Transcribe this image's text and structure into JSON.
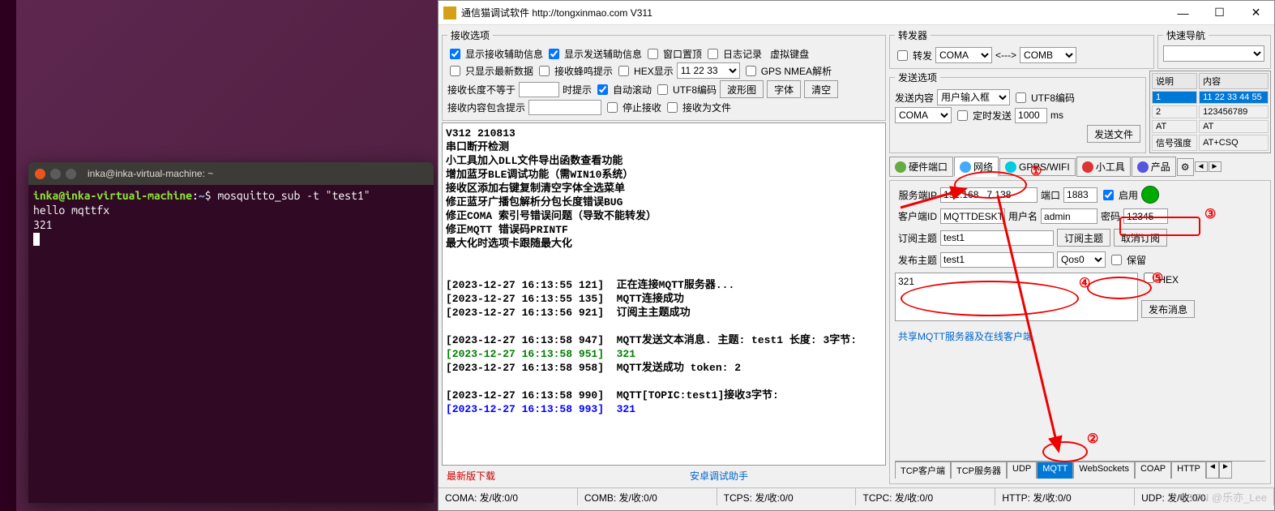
{
  "terminal": {
    "title": "inka@inka-virtual-machine: ~",
    "prompt_user": "inka@inka-virtual-machine",
    "prompt_path": "~",
    "command": "mosquitto_sub -t \"test1\"",
    "out1": "hello mqttfx",
    "out2": "321"
  },
  "app": {
    "title": "通信猫调试软件  http://tongxinmao.com  V311",
    "recv_opts": {
      "legend": "接收选项",
      "show_aux": "显示接收辅助信息",
      "show_send_aux": "显示发送辅助信息",
      "topmost": "窗口置顶",
      "log": "日志记录",
      "vkbd": "虚拟键盘",
      "only_latest": "只显示最新数据",
      "beep": "接收蜂鸣提示",
      "hex_disp": "HEX显示",
      "hex_val": "11 22 33",
      "gps": "GPS NMEA解析",
      "len_neq": "接收长度不等于",
      "len_hint": "时提示",
      "autoscroll": "自动滚动",
      "utf8": "UTF8编码",
      "wave_btn": "波形图",
      "font_btn": "字体",
      "clear_btn": "清空",
      "contains": "接收内容包含提示",
      "stop_recv": "停止接收",
      "as_file": "接收为文件"
    },
    "log_lines": [
      {
        "cls": "log-bold",
        "t": "V312 210813"
      },
      {
        "cls": "log-bold",
        "t": "串口断开检测"
      },
      {
        "cls": "log-bold",
        "t": "小工具加入DLL文件导出函数查看功能"
      },
      {
        "cls": "log-bold",
        "t": "增加蓝牙BLE调试功能（需WIN10系统）"
      },
      {
        "cls": "log-bold",
        "t": "接收区添加右键复制清空字体全选菜单"
      },
      {
        "cls": "log-bold",
        "t": "修正蓝牙广播包解析分包长度错误BUG"
      },
      {
        "cls": "log-bold",
        "t": "修正COMA 索引号错误问题（导致不能转发）"
      },
      {
        "cls": "log-bold",
        "t": "修正MQTT 错误码PRINTF"
      },
      {
        "cls": "log-bold",
        "t": "最大化时选项卡跟随最大化"
      },
      {
        "cls": "",
        "t": ""
      },
      {
        "cls": "",
        "t": ""
      },
      {
        "cls": "log-bold",
        "t": "[2023-12-27 16:13:55 121]  正在连接MQTT服务器..."
      },
      {
        "cls": "log-bold",
        "t": "[2023-12-27 16:13:55 135]  MQTT连接成功"
      },
      {
        "cls": "log-bold",
        "t": "[2023-12-27 16:13:56 921]  订阅主主题成功"
      },
      {
        "cls": "",
        "t": ""
      },
      {
        "cls": "log-bold",
        "t": "[2023-12-27 16:13:58 947]  MQTT发送文本消息. 主题: test1 长度: 3字节:"
      },
      {
        "cls": "log-green",
        "t": "[2023-12-27 16:13:58 951]  321"
      },
      {
        "cls": "log-bold",
        "t": "[2023-12-27 16:13:58 958]  MQTT发送成功 token: 2"
      },
      {
        "cls": "",
        "t": ""
      },
      {
        "cls": "log-bold",
        "t": "[2023-12-27 16:13:58 990]  MQTT[TOPIC:test1]接收3字节:"
      },
      {
        "cls": "log-blue",
        "t": "[2023-12-27 16:13:58 993]  321"
      }
    ],
    "bottom": {
      "latest": "最新版下载",
      "android": "安卓调试助手"
    },
    "status": {
      "coma": "COMA: 发/收:0/0",
      "comb": "COMB: 发/收:0/0",
      "tcps": "TCPS: 发/收:0/0",
      "tcpc": "TCPC: 发/收:0/0",
      "http": "HTTP: 发/收:0/0",
      "udp": "UDP: 发/收:0/0"
    },
    "forward": {
      "legend": "转发器",
      "fwd": "转发",
      "a": "COMA",
      "arrow": "<--->",
      "b": "COMB"
    },
    "quicknav": {
      "legend": "快速导航"
    },
    "send_opts": {
      "legend": "发送选项",
      "content_lbl": "发送内容",
      "content_sel": "用户输入框",
      "utf8": "UTF8编码",
      "port_sel": "COMA",
      "timed": "定时发送",
      "interval": "1000",
      "ms": "ms",
      "file_btn": "发送文件"
    },
    "info_table": {
      "h1": "说明",
      "h2": "内容",
      "rows": [
        {
          "c1": "1",
          "c2": "11 22 33 44 55"
        },
        {
          "c1": "2",
          "c2": "123456789"
        },
        {
          "c1": "AT",
          "c2": "AT"
        },
        {
          "c1": "信号强度",
          "c2": "AT+CSQ"
        }
      ]
    },
    "tabs": {
      "hw": "硬件端口",
      "net": "网络",
      "gprs": "GPRS/WIFI",
      "tools": "小工具",
      "prod": "产品"
    },
    "mqtt": {
      "server_lbl": "服务端IP",
      "server_ip": "192.168. .7.138",
      "port_lbl": "端口",
      "port": "1883",
      "enable": "启用",
      "client_lbl": "客户端ID",
      "client_id": "MQTTDESKT",
      "user_lbl": "用户名",
      "user": "admin",
      "pwd_lbl": "密码",
      "pwd": "12345",
      "sub_lbl": "订阅主题",
      "sub_topic": "test1",
      "sub_btn": "订阅主题",
      "unsub_btn": "取消订阅",
      "pub_lbl": "发布主题",
      "pub_topic": "test1",
      "qos": "Qos0",
      "retain": "保留",
      "msg": "321",
      "hex": "HEX",
      "send_btn": "发布消息",
      "share": "共享MQTT服务器及在线客户端"
    },
    "subtabs": [
      "TCP客户端",
      "TCP服务器",
      "UDP",
      "MQTT",
      "WebSockets",
      "COAP",
      "HTTP"
    ]
  },
  "annotations": {
    "n1": "①",
    "n2": "②",
    "n3": "③",
    "n4": "④",
    "n5": "⑤"
  },
  "watermark": "CSDN @乐亦_Lee"
}
